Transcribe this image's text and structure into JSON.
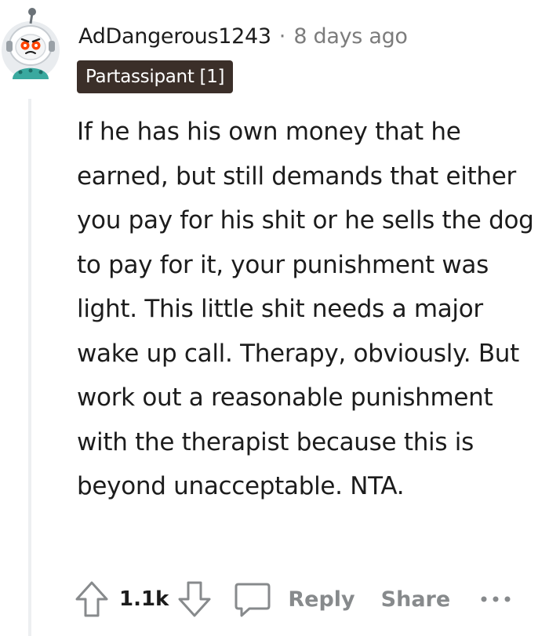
{
  "comment": {
    "author": "AdDangerous1243",
    "separator": "·",
    "timestamp": "8 days ago",
    "flair": "Partassipant [1]",
    "body": "If he has his own money that he earned, but still demands that either you pay for his shit or he sells the dog to pay for it, your punishment was light. This little shit needs a major wake up call. Therapy, obviously. But work out a reasonable punishment with the therapist because this is beyond unacceptable. NTA.",
    "score": "1.1k"
  },
  "actions": {
    "upvote_icon": "upvote-arrow-icon",
    "downvote_icon": "downvote-arrow-icon",
    "reply_icon": "comment-bubble-icon",
    "reply_label": "Reply",
    "share_label": "Share",
    "more_icon": "ellipsis-icon"
  },
  "colors": {
    "text": "#1c1c1c",
    "meta": "#7c7c7c",
    "action": "#878a8c",
    "flair_bg": "#3b2f29",
    "thread_line": "#edeff1"
  }
}
